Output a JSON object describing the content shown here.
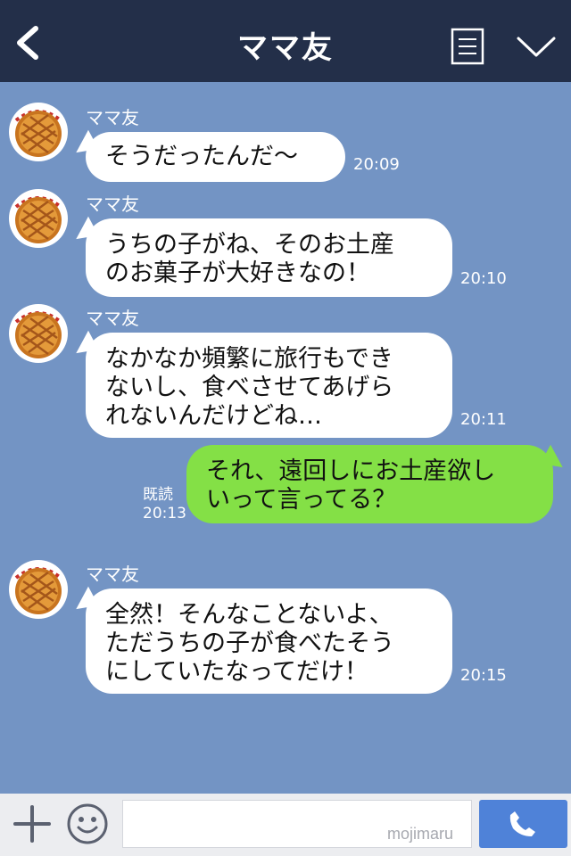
{
  "header": {
    "title": "ママ友",
    "back_icon": "chevron-left-icon",
    "notes_icon": "notes-icon",
    "menu_icon": "chevron-down-icon"
  },
  "messages": [
    {
      "sender": "ママ友",
      "text": "そうだったんだ〜",
      "time": "20:09",
      "direction": "incoming"
    },
    {
      "sender": "ママ友",
      "text": "うちの子がね、そのお土産\nのお菓子が大好きなの！",
      "time": "20:10",
      "direction": "incoming"
    },
    {
      "sender": "ママ友",
      "text": "なかなか頻繁に旅行もでき\nないし、食べさせてあげら\nれないんだけどね…",
      "time": "20:11",
      "direction": "incoming"
    },
    {
      "text": "それ、遠回しにお土産欲し\nいって言ってる？",
      "read": "既読",
      "time": "20:13",
      "direction": "outgoing"
    },
    {
      "sender": "ママ友",
      "text": "全然！そんなことないよ、\nただうちの子が食べたそう\nにしていたなってだけ！",
      "time": "20:15",
      "direction": "incoming"
    }
  ],
  "footer": {
    "input_value": "",
    "watermark": "mojimaru",
    "plus_icon": "plus-icon",
    "emoji_icon": "smile-icon",
    "call_icon": "phone-icon"
  },
  "colors": {
    "header_bg": "#232f49",
    "chat_bg": "#7394c4",
    "outgoing_bubble": "#84e046",
    "incoming_bubble": "#ffffff",
    "call_button": "#4f82d8"
  }
}
